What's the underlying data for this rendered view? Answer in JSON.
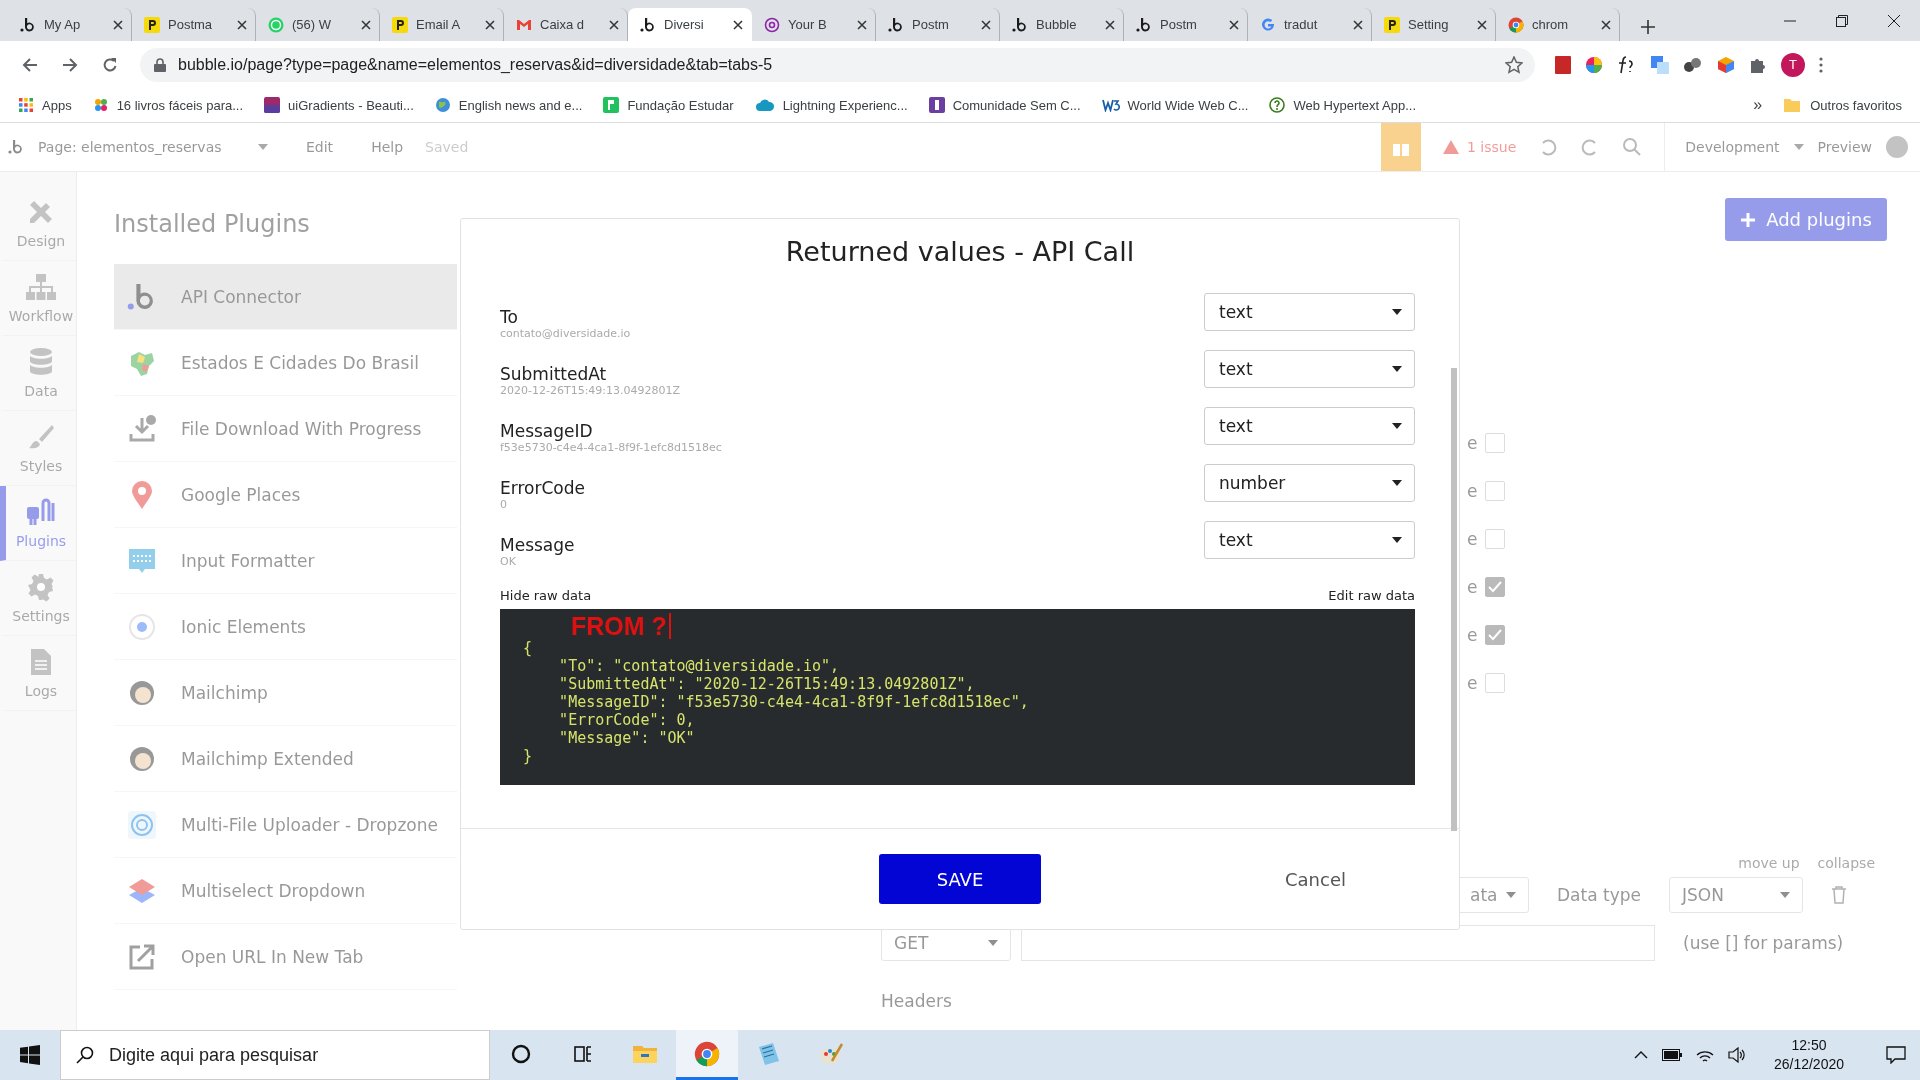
{
  "browser": {
    "tabs": [
      {
        "title": "My Ap",
        "kind": "bubble",
        "selected": false
      },
      {
        "title": "Postma",
        "kind": "postman",
        "selected": false
      },
      {
        "title": "(56) W",
        "kind": "whatsapp",
        "selected": false
      },
      {
        "title": "Email A",
        "kind": "postman",
        "selected": false
      },
      {
        "title": "Caixa d",
        "kind": "gmail",
        "selected": false
      },
      {
        "title": "Diversi",
        "kind": "bubble",
        "selected": true
      },
      {
        "title": "Your B",
        "kind": "at",
        "selected": false
      },
      {
        "title": "Postm",
        "kind": "bubble",
        "selected": false
      },
      {
        "title": "Bubble",
        "kind": "bubble",
        "selected": false
      },
      {
        "title": "Postm",
        "kind": "bubble",
        "selected": false
      },
      {
        "title": "tradut",
        "kind": "google",
        "selected": false
      },
      {
        "title": "Setting",
        "kind": "postman",
        "selected": false
      },
      {
        "title": "chrom",
        "kind": "chrome",
        "selected": false
      }
    ],
    "address": "bubble.io/page?type=page&name=elementos_reservas&id=diversidade&tab=tabs-5",
    "profile_initial": "T",
    "bookmarks": [
      {
        "label": "Apps",
        "kind": "grid"
      },
      {
        "label": "16 livros fáceis para...",
        "kind": "flower"
      },
      {
        "label": "uiGradients - Beauti...",
        "kind": "gradient"
      },
      {
        "label": "English news and e...",
        "kind": "globe"
      },
      {
        "label": "Fundação Estudar",
        "kind": "flag"
      },
      {
        "label": "Lightning Experienc...",
        "kind": "cloud"
      },
      {
        "label": "Comunidade Sem C...",
        "kind": "purple"
      },
      {
        "label": "World Wide Web C...",
        "kind": "w3"
      },
      {
        "label": "Web Hypertext App...",
        "kind": "question"
      }
    ],
    "overflow": "»",
    "other_bookmarks": "Outros favoritos"
  },
  "editor": {
    "header": {
      "page": "Page: elementos_reservas",
      "menus": [
        "Edit",
        "Help"
      ],
      "save_status": "Saved",
      "issues": "1 issue",
      "mode": "Development",
      "preview": "Preview"
    },
    "nav": [
      {
        "label": "Design",
        "kind": "design",
        "selected": false
      },
      {
        "label": "Workflow",
        "kind": "workflow",
        "selected": false
      },
      {
        "label": "Data",
        "kind": "data",
        "selected": false
      },
      {
        "label": "Styles",
        "kind": "styles",
        "selected": false
      },
      {
        "label": "Plugins",
        "kind": "plugins",
        "selected": true
      },
      {
        "label": "Settings",
        "kind": "settings",
        "selected": false
      },
      {
        "label": "Logs",
        "kind": "logs",
        "selected": false
      }
    ],
    "plugins_title": "Installed Plugins",
    "plugins": [
      {
        "name": "API Connector",
        "kind": "bubble",
        "selected": true
      },
      {
        "name": "Estados E Cidades Do Brasil",
        "kind": "map",
        "selected": false
      },
      {
        "name": "File Download With Progress",
        "kind": "download",
        "selected": false
      },
      {
        "name": "Google Places",
        "kind": "pin",
        "selected": false
      },
      {
        "name": "Input Formatter",
        "kind": "formatter",
        "selected": false
      },
      {
        "name": "Ionic Elements",
        "kind": "ionic",
        "selected": false
      },
      {
        "name": "Mailchimp",
        "kind": "monkey",
        "selected": false
      },
      {
        "name": "Mailchimp Extended",
        "kind": "monkey",
        "selected": false
      },
      {
        "name": "Multi-File Uploader - Dropzone",
        "kind": "uploader",
        "selected": false
      },
      {
        "name": "Multiselect Dropdown",
        "kind": "layers",
        "selected": false
      },
      {
        "name": "Open URL In New Tab",
        "kind": "external",
        "selected": false
      }
    ],
    "add_button": "Add plugins",
    "option_rows": [
      {
        "label": "e",
        "checked": false
      },
      {
        "label": "e",
        "checked": false
      },
      {
        "label": "e",
        "checked": false
      },
      {
        "label": "e",
        "checked": true
      },
      {
        "label": "e",
        "checked": true
      },
      {
        "label": "e",
        "checked": false
      }
    ],
    "call": {
      "move_up": "move up",
      "collapse": "collapse",
      "use_as": "ata",
      "data_type_label": "Data type",
      "data_type": "JSON",
      "method": "GET",
      "url_hint": "(use [] for params)",
      "headers": "Headers"
    }
  },
  "dialog": {
    "title": "Returned values - API Call",
    "fields": [
      {
        "name": "To",
        "sample": "contato@diversidade.io",
        "type": "text"
      },
      {
        "name": "SubmittedAt",
        "sample": "2020-12-26T15:49:13.0492801Z",
        "type": "text"
      },
      {
        "name": "MessageID",
        "sample": "f53e5730-c4e4-4ca1-8f9f-1efc8d1518ec",
        "type": "text"
      },
      {
        "name": "ErrorCode",
        "sample": "0",
        "type": "number"
      },
      {
        "name": "Message",
        "sample": "OK",
        "type": "text"
      }
    ],
    "hide_raw": "Hide raw data",
    "edit_raw": "Edit raw data",
    "annotation": "FROM ?",
    "raw_lines": [
      "{",
      "    \"To\": \"contato@diversidade.io\",",
      "    \"SubmittedAt\": \"2020-12-26T15:49:13.0492801Z\",",
      "    \"MessageID\": \"f53e5730-c4e4-4ca1-8f9f-1efc8d1518ec\",",
      "    \"ErrorCode\": 0,",
      "    \"Message\": \"OK\"",
      "}"
    ],
    "save": "SAVE",
    "cancel": "Cancel"
  },
  "taskbar": {
    "search_placeholder": "Digite aqui para pesquisar",
    "apps": [
      {
        "kind": "cortana",
        "selected": false
      },
      {
        "kind": "taskview",
        "selected": false
      },
      {
        "kind": "explorer",
        "selected": false
      },
      {
        "kind": "chrome",
        "selected": true
      },
      {
        "kind": "notepad",
        "selected": false
      },
      {
        "kind": "paint",
        "selected": false
      }
    ],
    "time": "12:50",
    "date": "26/12/2020"
  }
}
